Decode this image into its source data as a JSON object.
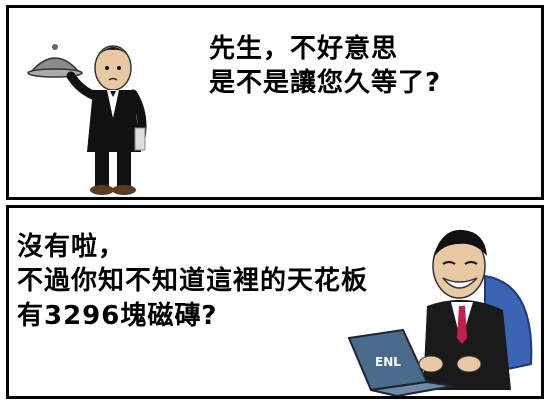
{
  "panels": [
    {
      "text_lines": [
        "先生，不好意思",
        "是不是讓您久等了?"
      ]
    },
    {
      "text_lines": [
        "沒有啦，",
        "不過你知不知道這裡的天花板",
        "有3296塊磁磚?"
      ],
      "laptop_label": "ENL"
    }
  ],
  "colors": {
    "border": "#000000",
    "background": "#ffffff",
    "suit": "#111111",
    "laptop": "#4a6b8c",
    "chair": "#3b64b5",
    "tie": "#c0204a"
  }
}
